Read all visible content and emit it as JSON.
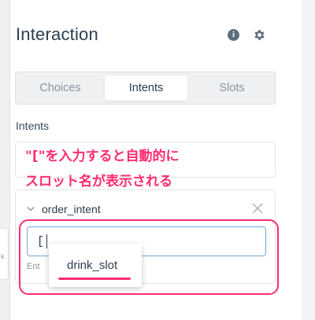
{
  "panel": {
    "title": "Interaction",
    "info_icon_glyph": "i"
  },
  "tabs": [
    {
      "label": "Choices",
      "active": false
    },
    {
      "label": "Intents",
      "active": true
    },
    {
      "label": "Slots",
      "active": false
    }
  ],
  "intents_section": {
    "label": "Intents"
  },
  "annotation": {
    "line1": "\"[\"を入力すると自動的に",
    "line2": "スロット名が表示される",
    "color": "#ff2d6f"
  },
  "intent_card": {
    "name": "order_intent",
    "input_value": "[",
    "helper_text": "Ent"
  },
  "suggestions": [
    {
      "label": "drink_slot"
    }
  ],
  "canvas": {
    "node_glyph": "k"
  },
  "colors": {
    "accent_pink": "#ff2d6f",
    "input_focus": "#6fa8dc",
    "text_primary": "#2c3e50",
    "text_muted": "#8a96a3"
  }
}
